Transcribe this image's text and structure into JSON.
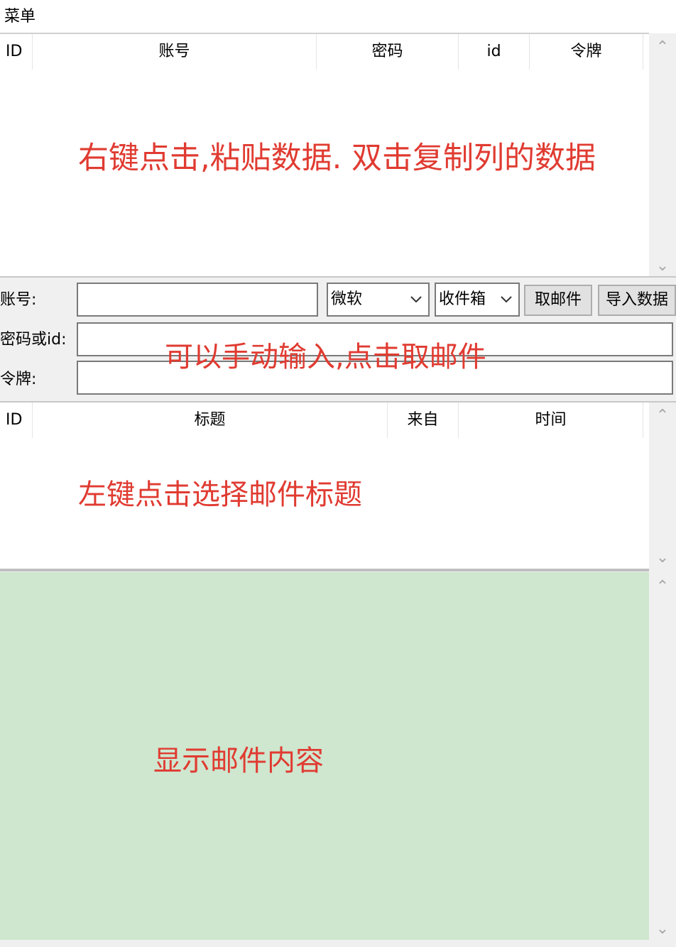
{
  "menu": {
    "label": "菜单"
  },
  "accounts_table": {
    "columns": [
      "ID",
      "账号",
      "密码",
      "id",
      "令牌"
    ],
    "hint": "右键点击,粘贴数据. 双击复制列的数据"
  },
  "form": {
    "account_label": "账号:",
    "account_value": "",
    "provider_selected": "微软",
    "folder_selected": "收件箱",
    "fetch_button": "取邮件",
    "import_button": "导入数据",
    "password_label": "密码或id:",
    "password_value": "",
    "token_label": "令牌:",
    "token_value": "",
    "hint": "可以手动输入,点击取邮件"
  },
  "mail_table": {
    "columns": [
      "ID",
      "标题",
      "来自",
      "时间"
    ],
    "hint": "左键点击选择邮件标题"
  },
  "content": {
    "hint": "显示邮件内容",
    "background": "#cfe6cf"
  },
  "colors": {
    "hint": "#e03b31"
  }
}
